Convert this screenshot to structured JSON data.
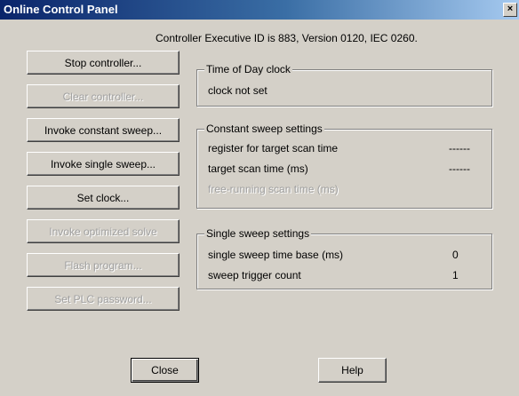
{
  "window": {
    "title": "Online Control Panel",
    "close_glyph": "×"
  },
  "header": {
    "executive_line": "Controller Executive ID is 883, Version 0120, IEC 0260."
  },
  "actions": {
    "stop_controller": "Stop controller...",
    "clear_controller": "Clear controller...",
    "invoke_constant_sweep": "Invoke constant sweep...",
    "invoke_single_sweep": "Invoke single sweep...",
    "set_clock": "Set clock...",
    "invoke_optimized_solve": "Invoke optimized solve",
    "flash_program": "Flash program...",
    "set_plc_password": "Set PLC password..."
  },
  "time_of_day": {
    "legend": "Time of Day clock",
    "status": "clock not set"
  },
  "constant_sweep": {
    "legend": "Constant sweep settings",
    "register_label": "register for target scan time",
    "register_value": "------",
    "target_label": "target scan time (ms)",
    "target_value": "------",
    "free_running_label": "free-running scan time (ms)"
  },
  "single_sweep": {
    "legend": "Single sweep settings",
    "time_base_label": "single sweep time base (ms)",
    "time_base_value": "0",
    "trigger_label": "sweep trigger count",
    "trigger_value": "1"
  },
  "footer": {
    "close_label": "Close",
    "help_label": "Help"
  }
}
